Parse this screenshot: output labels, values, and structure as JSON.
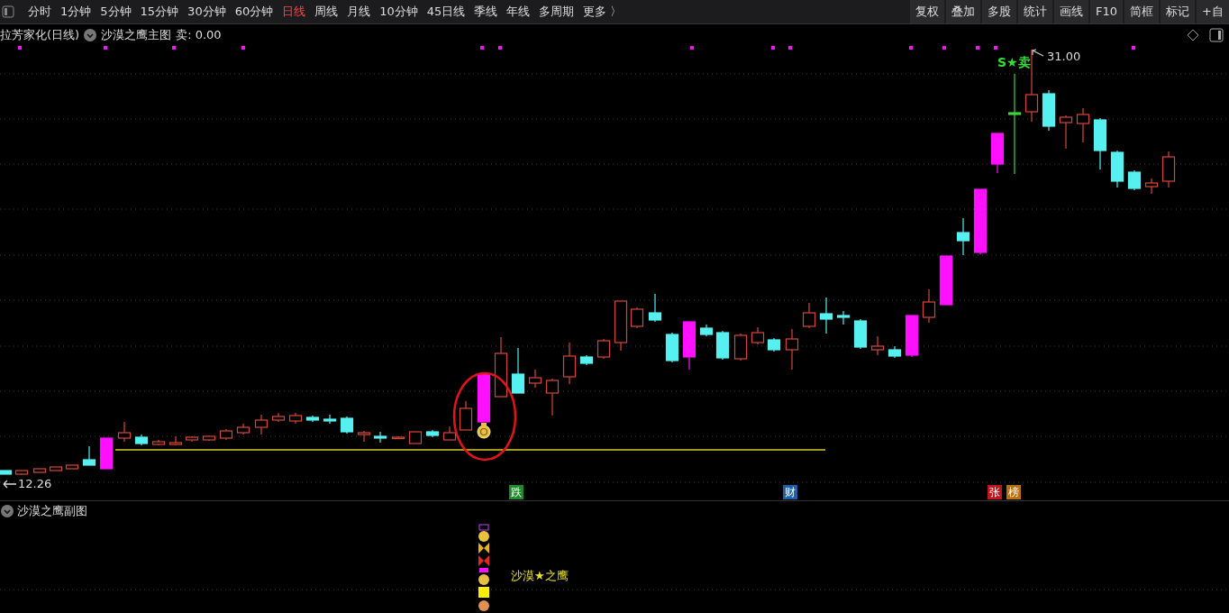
{
  "toolbar": {
    "periods": [
      {
        "label": "分时",
        "selected": false
      },
      {
        "label": "1分钟",
        "selected": false
      },
      {
        "label": "5分钟",
        "selected": false
      },
      {
        "label": "15分钟",
        "selected": false
      },
      {
        "label": "30分钟",
        "selected": false
      },
      {
        "label": "60分钟",
        "selected": false
      },
      {
        "label": "日线",
        "selected": true
      },
      {
        "label": "周线",
        "selected": false
      },
      {
        "label": "月线",
        "selected": false
      },
      {
        "label": "10分钟",
        "selected": false
      },
      {
        "label": "45日线",
        "selected": false
      },
      {
        "label": "季线",
        "selected": false
      },
      {
        "label": "年线",
        "selected": false
      },
      {
        "label": "多周期",
        "selected": false
      },
      {
        "label": "更多 〉",
        "selected": false
      }
    ],
    "tools": [
      "复权",
      "叠加",
      "多股",
      "统计",
      "画线",
      "F10",
      "简框",
      "标记",
      "+自"
    ]
  },
  "header": {
    "title": "拉芳家化(日线)",
    "indicator": "沙漠之鹰主图",
    "reading": "卖: 0.00"
  },
  "chart": {
    "high_label": "31.00",
    "low_label": "12.26",
    "signal_label": "S★卖",
    "events": [
      {
        "label": "跌",
        "color": "#1f8a2a"
      },
      {
        "label": "财",
        "color": "#1d5fa8"
      },
      {
        "label": "张",
        "color": "#c0161b"
      },
      {
        "label": "榜",
        "color": "#b8700f"
      }
    ]
  },
  "sub_pane": {
    "title": "沙漠之鹰副图",
    "signal_label": "沙漠★之鹰"
  }
}
